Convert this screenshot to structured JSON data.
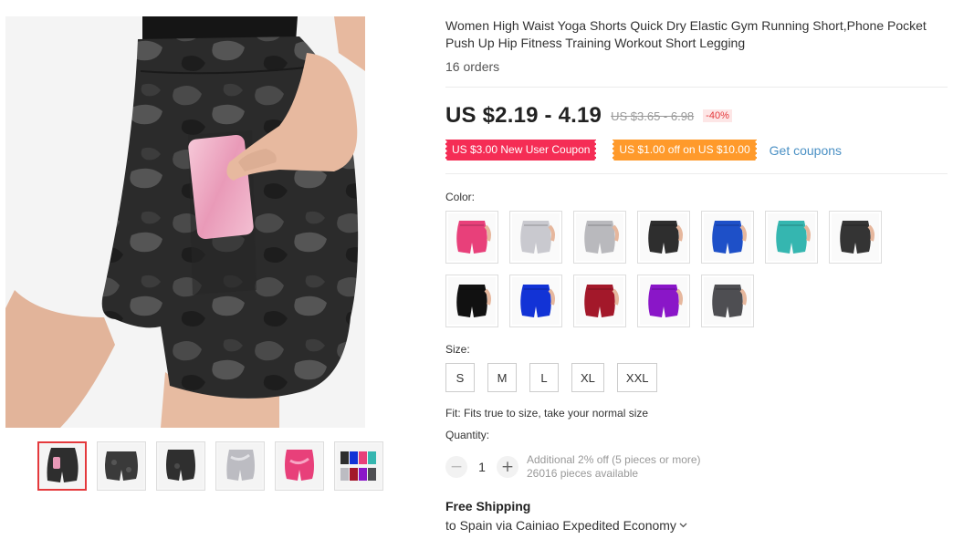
{
  "product": {
    "title": "Women High Waist Yoga Shorts Quick Dry Elastic Gym Running Short,Phone Pocket Push Up Hip Fitness Training Workout Short Legging",
    "orders": "16 orders"
  },
  "price": {
    "current": "US $2.19 - 4.19",
    "original": "US $3.65 - 6.98",
    "discount": "-40%"
  },
  "coupons": {
    "items": [
      {
        "label": "US $3.00 New User Coupon",
        "color": "#f52d55"
      },
      {
        "label": "US $1.00 off on US $10.00",
        "color": "#ff9a2b"
      }
    ],
    "get_label": "Get coupons"
  },
  "color": {
    "label": "Color:",
    "options": [
      {
        "name": "pink-tie-dye",
        "color": "#e8407a"
      },
      {
        "name": "white-grey-tie-dye",
        "color": "#c9c9cf"
      },
      {
        "name": "grey-marble",
        "color": "#b9b9bd"
      },
      {
        "name": "black-camo-pocket",
        "color": "#2e2e2e"
      },
      {
        "name": "blue-tie-dye",
        "color": "#1e50c8"
      },
      {
        "name": "teal-tie-dye",
        "color": "#35b6b0"
      },
      {
        "name": "black-camo",
        "color": "#343434"
      },
      {
        "name": "black",
        "color": "#111111"
      },
      {
        "name": "royal-blue",
        "color": "#1233d6"
      },
      {
        "name": "burgundy",
        "color": "#a3182a"
      },
      {
        "name": "purple",
        "color": "#8a16c8"
      },
      {
        "name": "dark-grey",
        "color": "#4e4e52"
      }
    ]
  },
  "size": {
    "label": "Size:",
    "options": [
      "S",
      "M",
      "L",
      "XL",
      "XXL"
    ]
  },
  "fit": "Fit: Fits true to size, take your normal size",
  "quantity": {
    "label": "Quantity:",
    "value": "1",
    "minus": "−",
    "plus": "+",
    "note1": "Additional 2% off (5 pieces or more)",
    "note2": "26016 pieces available"
  },
  "shipping": {
    "title": "Free Shipping",
    "detail": "to Spain via Cainiao Expedited Economy"
  },
  "gallery": {
    "thumbs": [
      {
        "name": "black-camo-pocket",
        "color": "#2e2e2e",
        "accent": "#e99ab8"
      },
      {
        "name": "black-camo",
        "color": "#3a3a3a",
        "accent": "#3a3a3a"
      },
      {
        "name": "black-camo-back",
        "color": "#2f2f2f",
        "accent": "#2f2f2f"
      },
      {
        "name": "grey-marble",
        "color": "#bcbcc2",
        "accent": "#bcbcc2"
      },
      {
        "name": "pink-tie-dye",
        "color": "#e8407a",
        "accent": "#e8407a"
      },
      {
        "name": "all-colors",
        "color": "#6b7fa8",
        "accent": "#e8407a"
      }
    ]
  }
}
